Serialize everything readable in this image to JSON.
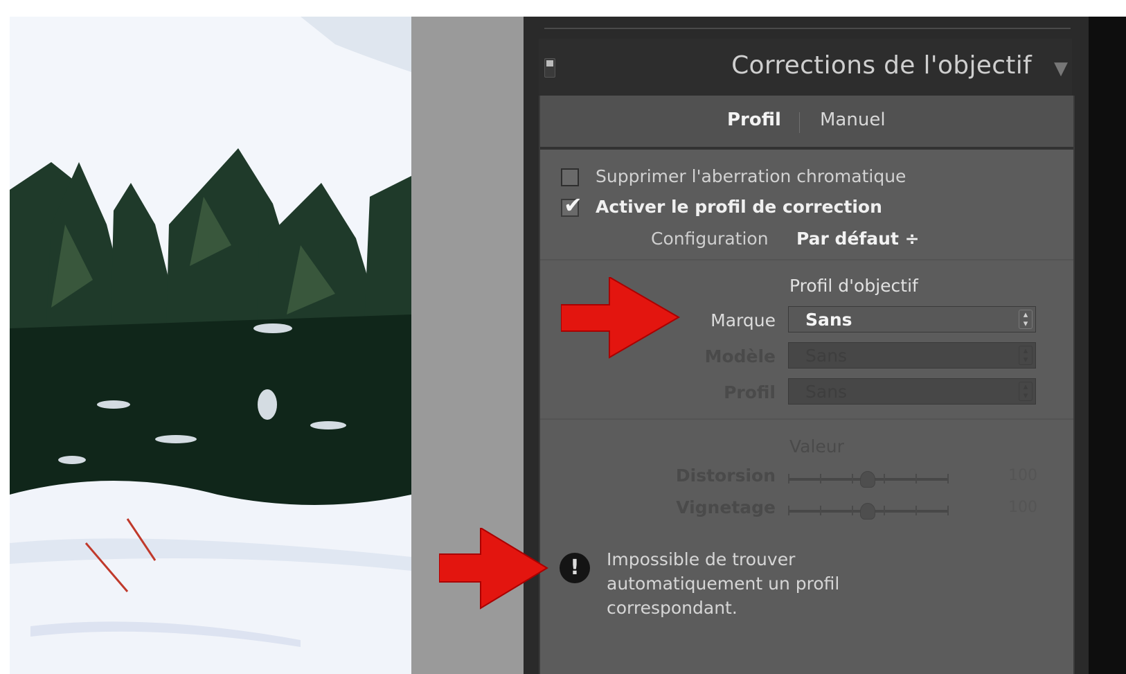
{
  "panel": {
    "title": "Corrections de l'objectif",
    "collapse_icon": "triangle-down-icon",
    "tabs": [
      {
        "label": "Profil",
        "active": true
      },
      {
        "label": "Manuel",
        "active": false
      }
    ],
    "checkbox_aberration": {
      "label": "Supprimer l'aberration chromatique",
      "checked": false
    },
    "checkbox_profile": {
      "label": "Activer le profil de correction",
      "checked": true
    },
    "configuration": {
      "label": "Configuration",
      "value": "Par défaut ÷"
    },
    "lens_profile": {
      "header": "Profil d'objectif",
      "fields": [
        {
          "label": "Marque",
          "value": "Sans",
          "enabled": true
        },
        {
          "label": "Modèle",
          "value": "Sans",
          "enabled": false
        },
        {
          "label": "Profil",
          "value": "Sans",
          "enabled": false
        }
      ]
    },
    "amount": {
      "header": "Valeur",
      "sliders": [
        {
          "label": "Distorsion",
          "value": "100"
        },
        {
          "label": "Vignetage",
          "value": "100"
        }
      ]
    },
    "warning": {
      "icon": "exclamation-icon",
      "text": "Impossible de trouver automatiquement un profil correspondant."
    }
  },
  "colors": {
    "panel_bg": "#5c5c5c",
    "header_bg": "#2d2d2d",
    "arrow": "#e3150f"
  }
}
